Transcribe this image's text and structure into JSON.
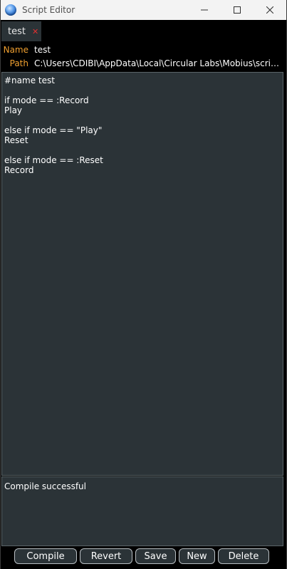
{
  "window": {
    "title": "Script Editor",
    "minimize_glyph": "—",
    "maximize_glyph": "☐",
    "close_glyph": "✕"
  },
  "tabs": [
    {
      "label": "test",
      "close_glyph": "✕",
      "close_color": "#e03030"
    }
  ],
  "info": {
    "name_key": "Name",
    "name_value": "test",
    "path_key": "Path",
    "path_value": "C:\\Users\\CDIBI\\AppData\\Local\\Circular Labs\\Mobius\\scripts\\test.mos"
  },
  "editor": {
    "lines": [
      "#name test",
      "",
      "if mode == :Record",
      "Play",
      "",
      "else if mode == \"Play\"",
      "Reset",
      "",
      "else if mode == :Reset",
      "Record"
    ]
  },
  "log": {
    "message": "Compile successful"
  },
  "buttons": {
    "compile": "Compile",
    "revert": "Revert",
    "save": "Save",
    "new": "New",
    "delete": "Delete"
  },
  "colors": {
    "panel_bg": "#2b3337",
    "key_color": "#f0a030",
    "text_color": "#ffffff"
  }
}
